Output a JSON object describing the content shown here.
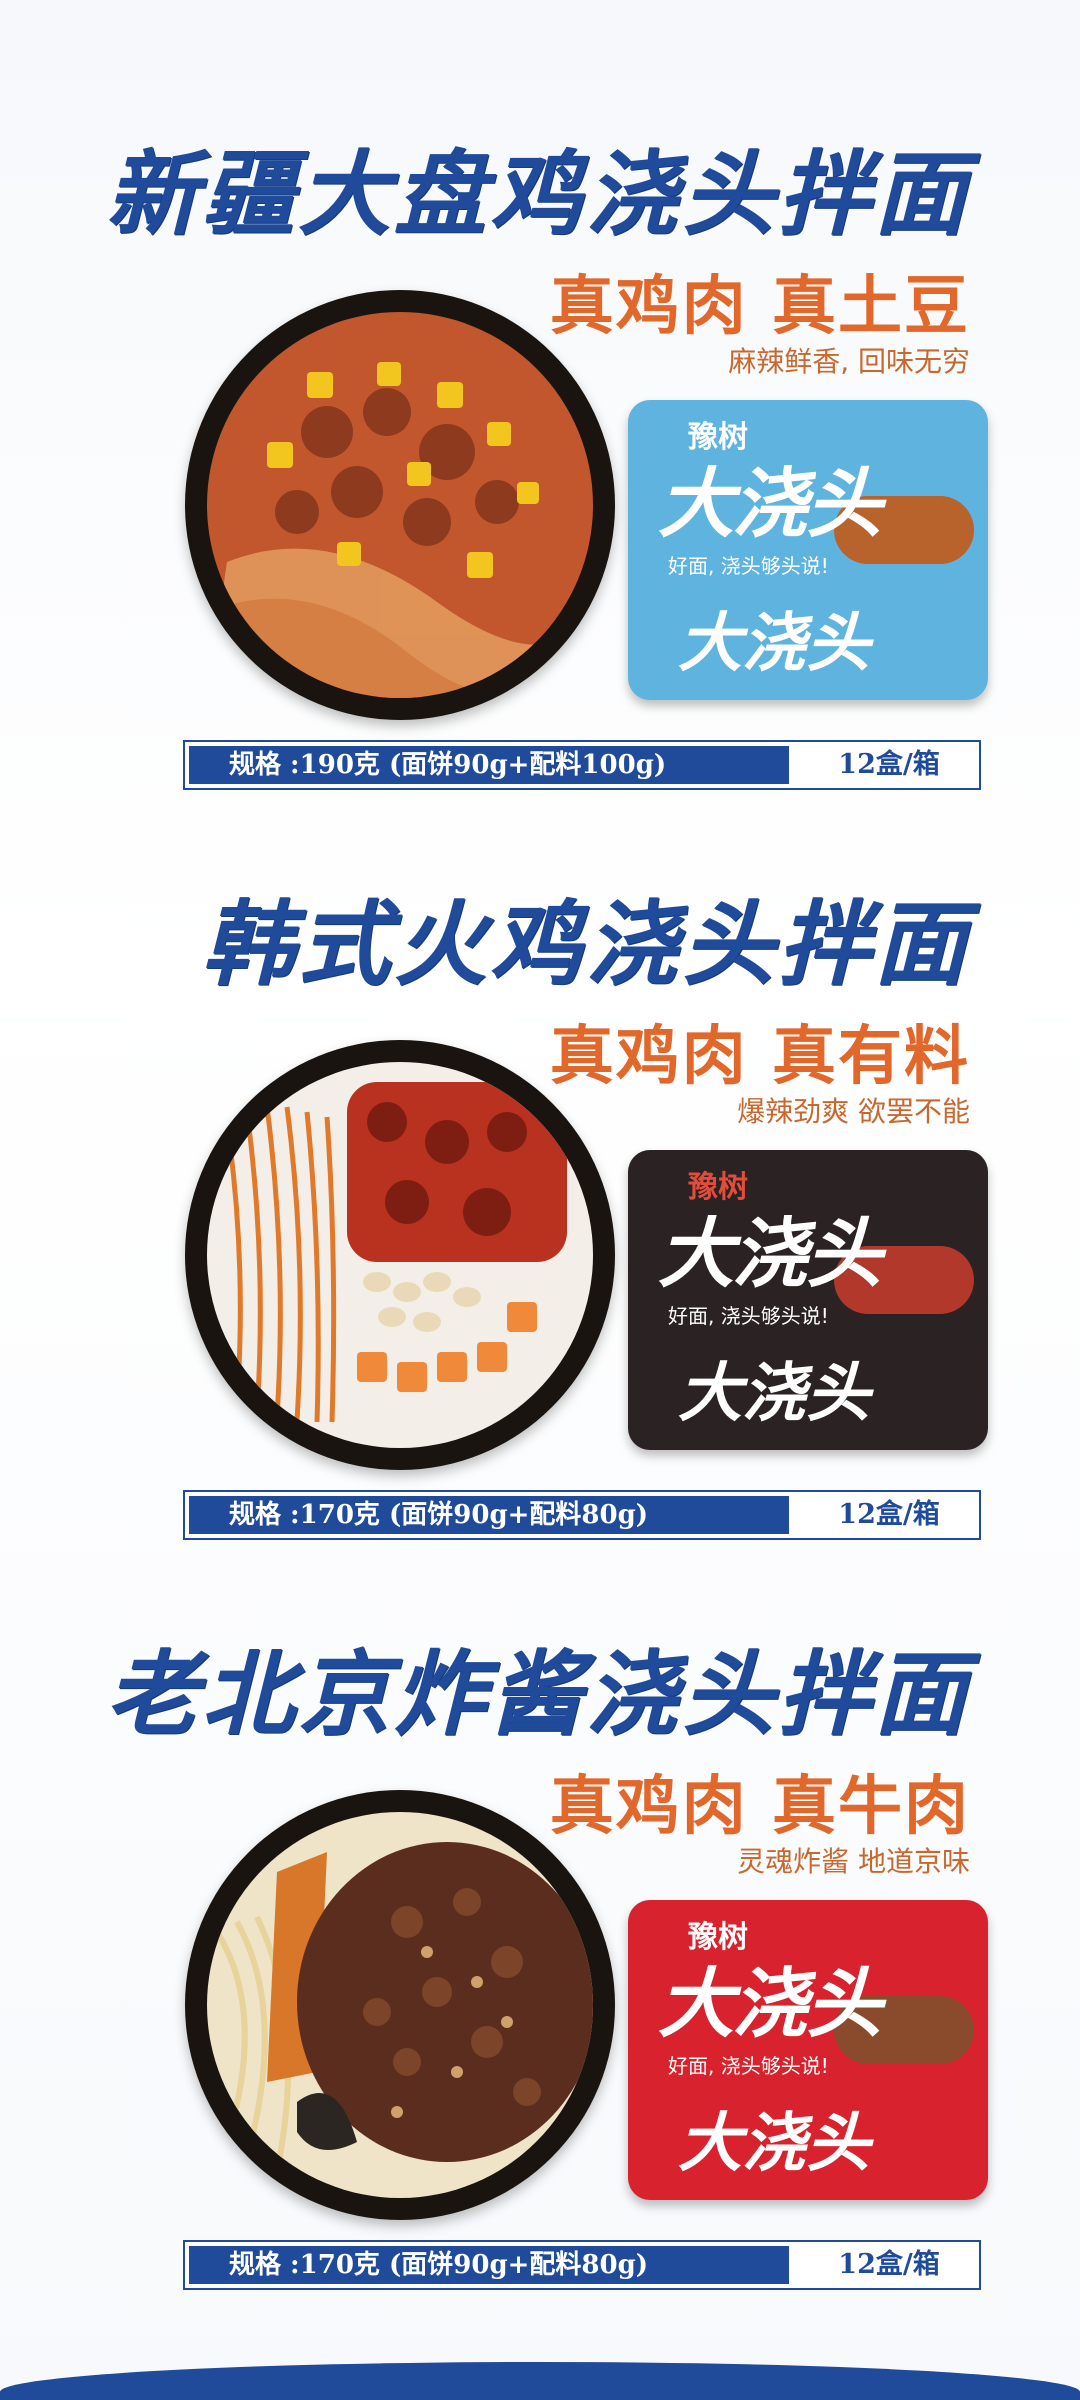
{
  "products": [
    {
      "title": "新疆大盘鸡浇头拌面",
      "tagline": "真鸡肉  真土豆",
      "subtag": "麻辣鲜香, 回味无穷",
      "package_brand": "豫树",
      "package_name": "大浇头",
      "package_slogan": "好面, 浇头够头说!",
      "spec": "规格 :190克 (面饼90g+配料100g)",
      "pack": "12盒/箱",
      "package_color": "#5fb3df"
    },
    {
      "title": "韩式火鸡浇头拌面",
      "tagline": "真鸡肉  真有料",
      "subtag": "爆辣劲爽  欲罢不能",
      "package_brand": "豫树",
      "package_name": "大浇头",
      "package_slogan": "好面, 浇头够头说!",
      "spec": "规格 :170克 (面饼90g+配料80g)",
      "pack": "12盒/箱",
      "package_color": "#2a2223"
    },
    {
      "title": "老北京炸酱浇头拌面",
      "tagline": "真鸡肉  真牛肉",
      "subtag": "灵魂炸酱  地道京味",
      "package_brand": "豫树",
      "package_name": "大浇头",
      "package_slogan": "好面, 浇头够头说!",
      "spec": "规格 :170克 (面饼90g+配料80g)",
      "pack": "12盒/箱",
      "package_color": "#d8232e"
    }
  ],
  "colors": {
    "title_blue": "#1f4b9a",
    "accent_orange": "#e2672a"
  }
}
